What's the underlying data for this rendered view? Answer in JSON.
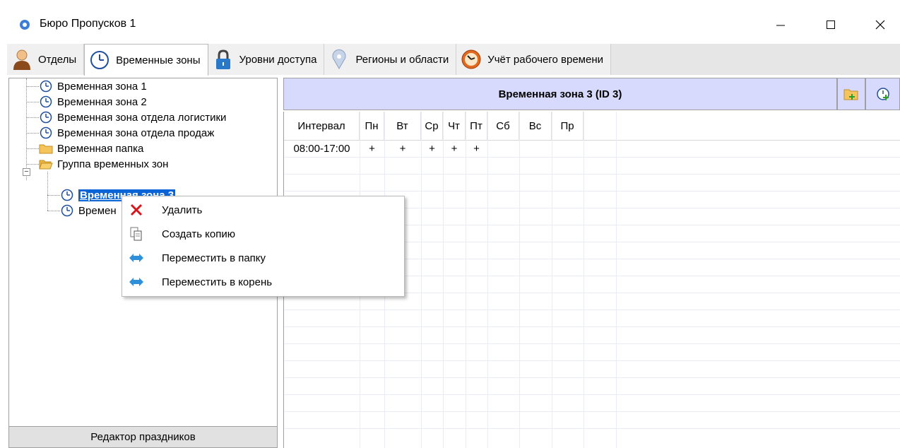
{
  "window": {
    "title": "Бюро Пропусков 1",
    "controls": [
      "minimize",
      "maximize",
      "close"
    ]
  },
  "tabs": [
    {
      "label": "Отделы",
      "icon": "person-icon"
    },
    {
      "label": "Временные зоны",
      "icon": "clock-icon",
      "active": true
    },
    {
      "label": "Уровни доступа",
      "icon": "lock-icon"
    },
    {
      "label": "Регионы и области",
      "icon": "pin-icon"
    },
    {
      "label": "Учёт рабочего времени",
      "icon": "stopwatch-icon"
    }
  ],
  "tree": {
    "items": [
      {
        "label": "Временная зона 1",
        "type": "timezone"
      },
      {
        "label": "Временная зона 2",
        "type": "timezone"
      },
      {
        "label": "Временная зона отдела логистики",
        "type": "timezone"
      },
      {
        "label": "Временная зона отдела продаж",
        "type": "timezone"
      },
      {
        "label": "Временная папка",
        "type": "folder"
      },
      {
        "label": "Группа временных зон",
        "type": "folder",
        "expanded": true
      },
      {
        "label": "Временная зона 3",
        "type": "timezone",
        "selected": true
      },
      {
        "label": "Времен",
        "type": "timezone"
      }
    ],
    "holiday_editor_label": "Редактор праздников"
  },
  "detail": {
    "header": "Временная зона 3 (ID 3)",
    "columns": [
      "Интервал",
      "Пн",
      "Вт",
      "Ср",
      "Чт",
      "Пт",
      "Сб",
      "Вс",
      "Пр"
    ],
    "rows": [
      [
        "08:00-17:00",
        "+",
        "+",
        "+",
        "+",
        "+",
        "",
        "",
        ""
      ]
    ]
  },
  "context_menu": [
    {
      "label": "Удалить",
      "icon": "delete-x-icon"
    },
    {
      "label": "Создать копию",
      "icon": "copy-icon"
    },
    {
      "label": "Переместить в папку",
      "icon": "move-arrow-icon"
    },
    {
      "label": "Переместить в корень",
      "icon": "move-arrow-icon"
    }
  ],
  "colors": {
    "selection": "#0a64d6",
    "header_bg": "#d7dafc",
    "delete_red": "#d8151c",
    "move_blue": "#2f8fd8"
  }
}
